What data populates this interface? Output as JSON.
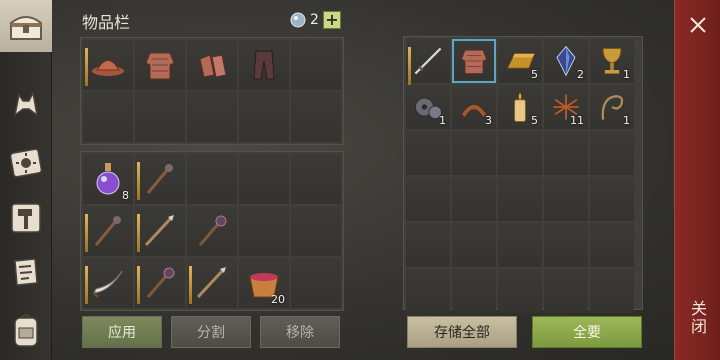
{
  "header": {
    "title": "物品栏",
    "gem_count": "2"
  },
  "buttons": {
    "apply": "应用",
    "split": "分割",
    "remove": "移除",
    "store_all": "存储全部",
    "take_all": "全要",
    "close": "关闭"
  },
  "equipment": {
    "slots": [
      {
        "icon": "leather-cap-icon",
        "count": ""
      },
      {
        "icon": "chainmail-armor-icon",
        "count": ""
      },
      {
        "icon": "chainmail-gloves-icon",
        "count": ""
      },
      {
        "icon": "leather-pants-icon",
        "count": ""
      }
    ]
  },
  "backpack": {
    "slots": [
      {
        "icon": "potion-flask-icon",
        "count": "8"
      },
      {
        "icon": "spiked-mace-icon",
        "count": ""
      },
      {
        "icon": "spiked-mace-icon",
        "count": ""
      },
      {
        "icon": "spear-icon",
        "count": ""
      },
      {
        "icon": "morningstar-icon",
        "count": ""
      },
      {
        "icon": "scimitar-icon",
        "count": ""
      },
      {
        "icon": "morningstar-icon",
        "count": ""
      },
      {
        "icon": "spear-icon",
        "count": ""
      },
      {
        "icon": "berry-basket-icon",
        "count": "20"
      }
    ]
  },
  "storage": {
    "slots": [
      {
        "icon": "steel-sword-icon",
        "count": ""
      },
      {
        "icon": "chainmail-armor-icon",
        "count": ""
      },
      {
        "icon": "bronze-ingot-icon",
        "count": "5"
      },
      {
        "icon": "crystal-shard-icon",
        "count": "2"
      },
      {
        "icon": "golden-goblet-icon",
        "count": "1"
      },
      {
        "icon": "gear-mechanism-icon",
        "count": "1"
      },
      {
        "icon": "leather-roll-icon",
        "count": "3"
      },
      {
        "icon": "candle-icon",
        "count": "5"
      },
      {
        "icon": "copper-wire-icon",
        "count": "11"
      },
      {
        "icon": "rope-icon",
        "count": "1"
      }
    ]
  },
  "colors": {
    "accent": "#e0b45a",
    "close": "#8a2a24",
    "selected": "#5aa7c8"
  }
}
